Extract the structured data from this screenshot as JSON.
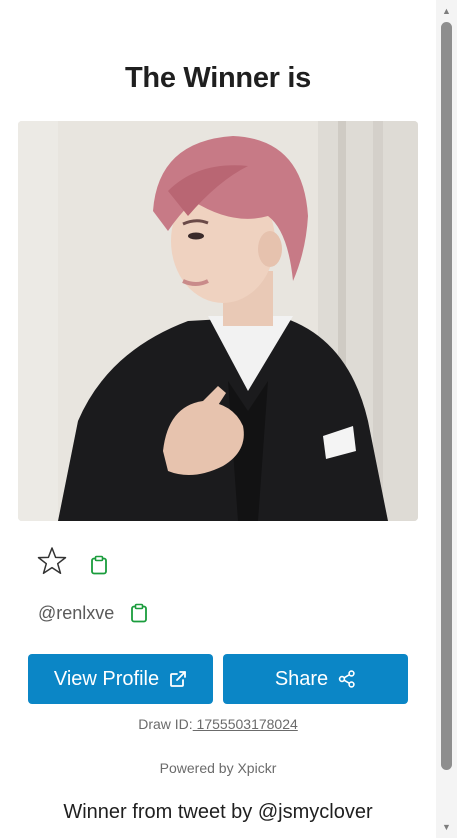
{
  "title": "The Winner is",
  "winner": {
    "username": "@renlxve"
  },
  "buttons": {
    "view_profile": "View Profile",
    "share": "Share"
  },
  "draw": {
    "label": "Draw ID:",
    "id": " 1755503178024"
  },
  "powered_by": "Powered by Xpickr",
  "tweet_note": "Winner from tweet by @jsmyclover",
  "icons": {
    "favorite": "star-outline-icon",
    "copy": "clipboard-icon",
    "external": "external-link-icon",
    "share": "share-nodes-icon",
    "scroll_up": "triangle-up-icon",
    "scroll_down": "triangle-down-icon"
  },
  "colors": {
    "primary_button": "#0b86c6",
    "clipboard_icon": "#1a9c3c",
    "text_muted": "#6b6b6b"
  }
}
